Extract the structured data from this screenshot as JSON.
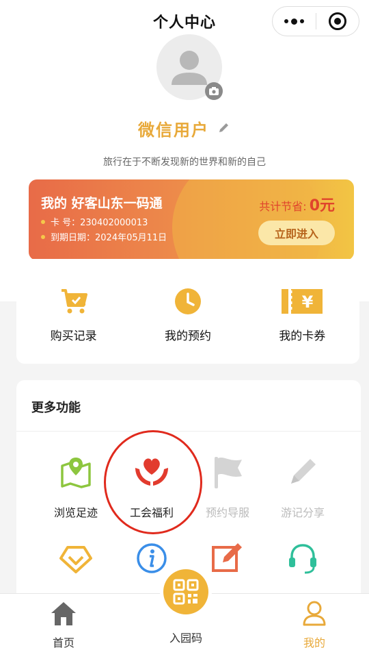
{
  "nav": {
    "title": "个人中心"
  },
  "profile": {
    "username": "微信用户",
    "slogan": "旅行在于不断发现新的世界和新的自己"
  },
  "card": {
    "title": "我的 好客山东一码通",
    "card_no": "卡 号：230402000013",
    "expiry": "到期日期：2024年05月11日",
    "savings_label": "共计节省:",
    "savings_amount": "0元",
    "enter_label": "立即进入"
  },
  "quick_actions": [
    {
      "label": "购买记录",
      "icon": "shopping-cart-icon"
    },
    {
      "label": "我的预约",
      "icon": "clock-icon"
    },
    {
      "label": "我的卡券",
      "icon": "coupon-ticket-icon"
    }
  ],
  "more": {
    "title": "更多功能",
    "items": [
      {
        "label": "浏览足迹",
        "icon": "map-pin-icon"
      },
      {
        "label": "工会福利",
        "icon": "heart-hands-icon"
      },
      {
        "label": "预约导服",
        "icon": "flag-icon"
      },
      {
        "label": "游记分享",
        "icon": "pencil-icon"
      },
      {
        "label": "",
        "icon": "heart-badge-icon"
      },
      {
        "label": "",
        "icon": "info-icon"
      },
      {
        "label": "",
        "icon": "edit-note-icon"
      },
      {
        "label": "",
        "icon": "headset-icon"
      }
    ]
  },
  "tabbar": {
    "home": "首页",
    "scan": "入园码",
    "mine": "我的"
  },
  "colors": {
    "accent": "#e8a93a",
    "green": "#8dc63f",
    "red": "#e23b2e",
    "blue": "#3a8ee8",
    "teal": "#2fbf9a",
    "highlight": "#e02a1d"
  }
}
